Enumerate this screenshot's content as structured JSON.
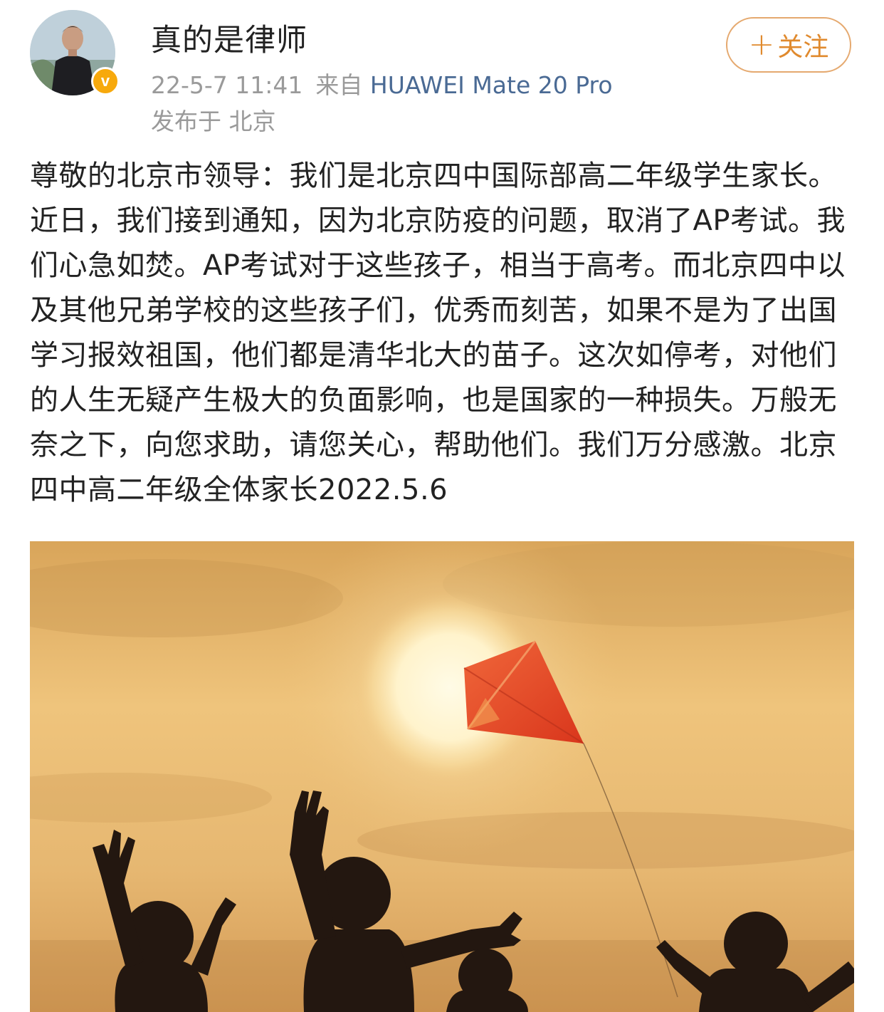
{
  "author": {
    "name": "真的是律师",
    "avatar_icon": "person-portrait-icon",
    "badge_icon": "verified-v-icon",
    "badge_label": "v",
    "badge_color": "#f7a90c"
  },
  "meta": {
    "timestamp": "22-5-7 11:41",
    "source_prefix": "来自",
    "device": "HUAWEI Mate 20 Pro",
    "location": "发布于 北京"
  },
  "follow_button": {
    "plus": "+",
    "label": "关注",
    "color": "#e08a2e"
  },
  "post": {
    "text": "尊敬的北京市领导：我们是北京四中国际部高二年级学生家长。近日，我们接到通知，因为北京防疫的问题，取消了AP考试。我们心急如焚。AP考试对于这些孩子，相当于高考。而北京四中以及其他兄弟学校的这些孩子们，优秀而刻苦，如果不是为了出国学习报效祖国，他们都是清华北大的苗子。这次如停考，对他们的人生无疑产生极大的负面影响，也是国家的一种损失。万般无奈之下，向您求助，请您关心，帮助他们。我们万分感激。北京四中高二年级全体家长2022.5.6"
  },
  "image": {
    "subject": "kite-flying-children-sunset-photo",
    "kite_color": "#e8502a",
    "sky_color": "#e9b664"
  }
}
